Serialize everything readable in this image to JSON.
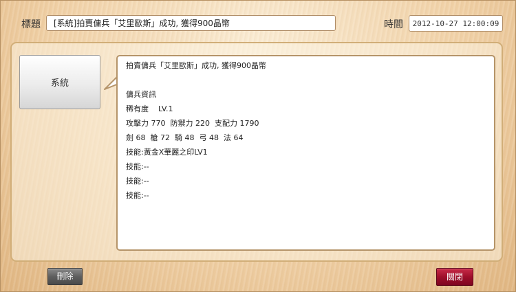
{
  "header": {
    "title_label": "標題",
    "title_value": "[系統]拍賣傭兵「艾里歐斯」成功, 獲得900晶幣",
    "time_label": "時間",
    "time_value": "2012-10-27 12:00:09"
  },
  "sender": {
    "name": "系統"
  },
  "message": {
    "lines": [
      "拍賣傭兵「艾里歐斯」成功, 獲得900晶幣",
      "",
      "傭兵資訊",
      "稀有度    LV.1",
      "攻擊力 770  防禦力 220  支配力 1790",
      "劍 68  槍 72  騎 48  弓 48  法 64",
      "技能:黃金X華麗之印LV1",
      "技能:--",
      "技能:--",
      "技能:--"
    ]
  },
  "buttons": {
    "delete_label": "刪除",
    "close_label": "關閉"
  }
}
